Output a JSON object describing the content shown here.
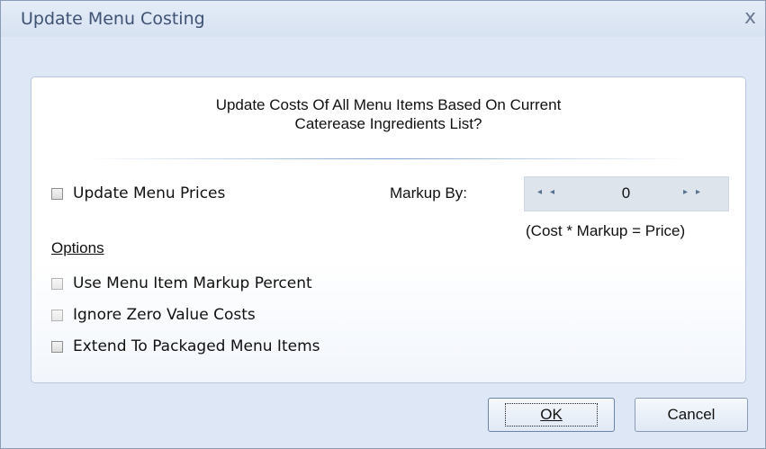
{
  "window": {
    "title": "Update Menu Costing",
    "close_glyph": "x"
  },
  "question": {
    "line1": "Update Costs Of All Menu Items Based On Current",
    "line2": "Caterease Ingredients List?"
  },
  "update_prices": {
    "label": "Update Menu Prices",
    "checked": false
  },
  "markup": {
    "label": "Markup By:",
    "value": "0",
    "decrease_glyph": "◂◂",
    "increase_glyph": "▸▸",
    "formula": "(Cost * Markup = Price)"
  },
  "options": {
    "heading": "Options",
    "items": [
      {
        "label": "Use Menu Item Markup Percent",
        "checked": false,
        "enabled": false
      },
      {
        "label": "Ignore Zero Value Costs",
        "checked": false,
        "enabled": false
      },
      {
        "label": "Extend To Packaged Menu Items",
        "checked": false,
        "enabled": true
      }
    ]
  },
  "buttons": {
    "ok": "OK",
    "cancel": "Cancel"
  },
  "colors": {
    "title_text": "#3e5273",
    "dialog_bg": "#dde7f5",
    "panel_border": "#b9c8de",
    "separator": "#7fa3d3"
  }
}
